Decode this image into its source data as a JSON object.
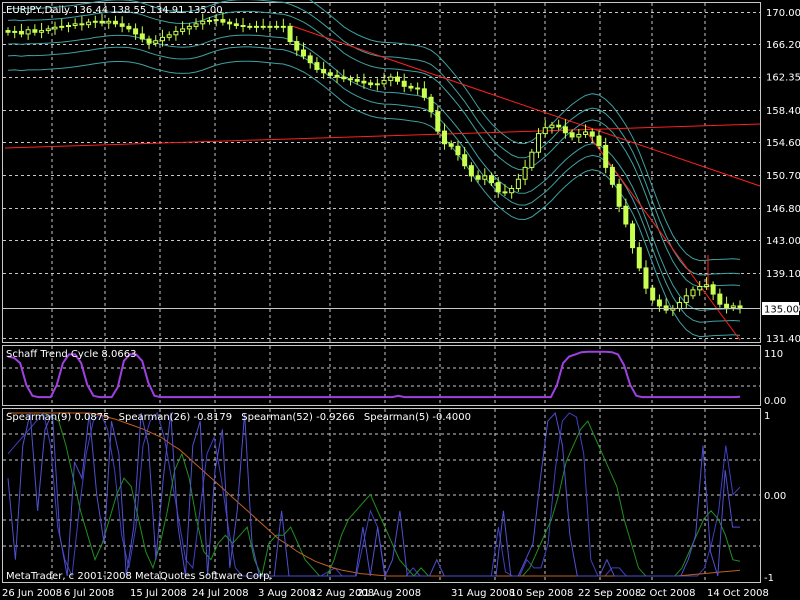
{
  "colors": {
    "background": "#000000",
    "grid": "#c8c8c8",
    "text": "#ffffff",
    "candle": "#c8ff50",
    "envelope": "#40a0a0",
    "trendline": "#ff2020",
    "stc": "#a040e0",
    "sp9": "#4040c0",
    "sp26": "#209020",
    "sp52": "#c06020",
    "sp5": "#5050d0"
  },
  "header": {
    "title": "EURJPY,Daily  136.44 138.55 134.91 135.00"
  },
  "current_price": "135.00",
  "footer": {
    "copyright": "MetaTrader, c 2001-2008 MetaQuotes Software Corp."
  },
  "chart_data": [
    {
      "type": "candlestick",
      "title": "EURJPY,Daily",
      "ohlc_header": "136.44 138.55 134.91 135.00",
      "ylim": [
        131.4,
        170.0
      ],
      "y_ticks": [
        "170.00",
        "166.20",
        "162.35",
        "158.40",
        "154.60",
        "150.70",
        "146.80",
        "143.00",
        "139.10",
        "135.00",
        "131.40"
      ],
      "x_ticks": [
        "26 Jun 2008",
        "6 Jul 2008",
        "15 Jul 2008",
        "24 Jul 2008",
        "3 Aug 2008",
        "12 Aug 2008",
        "21 Aug 2008",
        "31 Aug 2008",
        "10 Sep 2008",
        "22 Sep 2008",
        "2 Oct 2008",
        "14 Oct 2008"
      ],
      "closes": [
        167.6,
        167.7,
        167.4,
        167.9,
        167.6,
        167.8,
        168.0,
        168.2,
        168.3,
        168.4,
        168.6,
        168.5,
        168.8,
        168.9,
        168.7,
        168.9,
        168.6,
        168.3,
        168.0,
        167.4,
        166.8,
        166.3,
        166.6,
        167.0,
        167.3,
        167.7,
        168.0,
        168.3,
        168.6,
        168.9,
        169.0,
        169.1,
        168.8,
        168.6,
        168.4,
        168.3,
        168.3,
        168.3,
        168.3,
        168.3,
        168.3,
        168.3,
        166.5,
        165.5,
        164.8,
        164.0,
        163.2,
        162.8,
        162.5,
        162.3,
        162.1,
        162.0,
        161.8,
        161.6,
        161.4,
        161.5,
        161.9,
        162.3,
        161.8,
        161.2,
        161.0,
        160.9,
        159.9,
        158.2,
        155.9,
        154.4,
        154.1,
        153.1,
        151.8,
        150.6,
        150.2,
        150.6,
        149.8,
        148.7,
        148.6,
        149.1,
        150.2,
        151.6,
        153.4,
        155.6,
        156.3,
        156.6,
        156.4,
        155.7,
        155.2,
        155.5,
        155.8,
        155.3,
        154.2,
        151.6,
        149.6,
        147.0,
        144.9,
        142.1,
        139.7,
        137.3,
        135.9,
        135.2,
        134.7,
        134.9,
        135.6,
        136.4,
        137.1,
        137.5,
        137.7,
        136.6,
        135.4,
        135.0,
        135.2,
        135.0
      ],
      "reference_level": 135.0,
      "annotations": [
        "Bollinger-style envelope bands (3 upper, 3 lower)",
        "Red trend lines"
      ]
    },
    {
      "type": "line",
      "title": "Schaff Trend Cycle 8.0663",
      "ylim": [
        0,
        110
      ],
      "y_ticks": [
        "110",
        "0.00"
      ],
      "series": [
        {
          "name": "Schaff Trend Cycle",
          "values": [
            95,
            92,
            80,
            30,
            5,
            2,
            2,
            2,
            30,
            80,
            100,
            100,
            80,
            30,
            5,
            2,
            2,
            2,
            25,
            85,
            100,
            100,
            85,
            35,
            5,
            2,
            2,
            2,
            2,
            2,
            2,
            2,
            2,
            2,
            2,
            2,
            2,
            2,
            2,
            2,
            2,
            2,
            2,
            2,
            2,
            2,
            2,
            2,
            2,
            2,
            2,
            2,
            2,
            2,
            2,
            2,
            2,
            2,
            2,
            2,
            2,
            2,
            2,
            2,
            5,
            2,
            2,
            2,
            2,
            2,
            2,
            2,
            2,
            2,
            2,
            2,
            2,
            2,
            2,
            2,
            2,
            2,
            2,
            2,
            2,
            2,
            2,
            2,
            2,
            2,
            30,
            80,
            95,
            100,
            105,
            106,
            106,
            106,
            106,
            105,
            100,
            75,
            30,
            5,
            2,
            2,
            2,
            2,
            2,
            2,
            2,
            2,
            2,
            2,
            2,
            2,
            2,
            2,
            2,
            2,
            3
          ]
        }
      ]
    },
    {
      "type": "line",
      "title": "Spearman",
      "ylim": [
        -1,
        1
      ],
      "y_ticks": [
        "1",
        "0.00",
        "-1"
      ],
      "series": [
        {
          "name": "Spearman(9) 0.0875",
          "values": [
            0.5,
            0.6,
            0.7,
            0.8,
            0.9,
            1.0,
            0.6,
            -0.4,
            -0.8,
            -1.0,
            -0.2,
            0.5,
            0.9,
            1.0,
            0.8,
            0.3,
            -0.5,
            -0.9,
            -0.4,
            0.6,
            0.9,
            1.0,
            0.7,
            0.2,
            -0.3,
            -0.8,
            -0.9,
            -0.2,
            0.5,
            0.7,
            0.2,
            -0.4,
            -0.9,
            -1.0,
            -1.0,
            -1.0,
            -1.0,
            -1.0,
            -1.0,
            -1.0,
            -1.0,
            -1.0,
            -1.0,
            -1.0,
            -1.0,
            -0.95,
            -0.9,
            -1.0,
            -1.0,
            -1.0,
            -0.6,
            -0.2,
            -0.4,
            -1.0,
            -1.0,
            -1.0,
            -1.0,
            -0.9,
            -1.0,
            -1.0,
            -1.0,
            -1.0,
            -1.0,
            -1.0,
            -1.0,
            -1.0,
            -1.0,
            -1.0,
            -1.0,
            -0.4,
            -0.95,
            -1.0,
            -1.0,
            -0.8,
            -0.9,
            -0.9,
            -0.6,
            0.3,
            0.9,
            1.0,
            0.95,
            0.5,
            -0.8,
            -1.0,
            -1.0,
            -0.9,
            -0.9,
            -1.0,
            -1.0,
            -1.0,
            -1.0,
            -1.0,
            -1.0,
            -1.0,
            -1.0,
            -1.0,
            -1.0,
            -1.0,
            -0.9,
            -0.6,
            -0.2,
            0.6,
            0.0,
            0.09
          ]
        },
        {
          "name": "Spearman(26) -0.8179",
          "values": [
            1.0,
            1.0,
            1.0,
            1.0,
            1.0,
            1.0,
            0.95,
            0.9,
            0.6,
            0.2,
            -0.2,
            -0.5,
            -0.8,
            -0.6,
            -0.3,
            0.0,
            0.2,
            0.1,
            -0.3,
            -0.7,
            -0.9,
            -0.6,
            -0.2,
            0.3,
            0.5,
            0.2,
            -0.3,
            -0.7,
            -0.8,
            -0.6,
            -0.5,
            -0.6,
            -0.5,
            -0.4,
            -0.8,
            -1.0,
            -0.6,
            -0.5,
            -0.5,
            -0.4,
            -0.6,
            -0.8,
            -0.9,
            -1.0,
            -1.0,
            -0.8,
            -0.5,
            -0.3,
            -0.2,
            -0.1,
            0.0,
            -0.2,
            -0.4,
            -0.6,
            -0.8,
            -0.9,
            -1.0,
            -0.9,
            -1.0,
            -1.0,
            -1.0,
            -1.0,
            -1.0,
            -1.0,
            -1.0,
            -1.0,
            -1.0,
            -1.0,
            -1.0,
            -1.0,
            -1.0,
            -1.0,
            -0.9,
            -0.7,
            -0.5,
            -0.3,
            0.0,
            0.4,
            0.6,
            0.8,
            0.9,
            0.7,
            0.5,
            0.3,
            0.1,
            -0.3,
            -0.6,
            -0.9,
            -1.0,
            -1.0,
            -1.0,
            -1.0,
            -1.0,
            -0.9,
            -0.7,
            -0.5,
            -0.3,
            -0.2,
            -0.3,
            -0.5,
            -0.8,
            -0.82
          ]
        },
        {
          "name": "Spearman(52) -0.9266",
          "values": [
            1.0,
            1.0,
            1.0,
            1.0,
            1.0,
            1.0,
            1.0,
            1.0,
            1.0,
            1.0,
            0.98,
            0.95,
            0.92,
            0.88,
            0.84,
            0.8,
            0.75,
            0.7,
            0.62,
            0.55,
            0.45,
            0.35,
            0.25,
            0.15,
            0.05,
            -0.05,
            -0.15,
            -0.25,
            -0.35,
            -0.45,
            -0.55,
            -0.62,
            -0.7,
            -0.76,
            -0.82,
            -0.86,
            -0.9,
            -0.93,
            -0.95,
            -0.97,
            -0.98,
            -0.99,
            -1.0,
            -1.0,
            -1.0,
            -1.0,
            -1.0,
            -1.0,
            -1.0,
            -1.0,
            -1.0,
            -1.0,
            -1.0,
            -1.0,
            -1.0,
            -1.0,
            -1.0,
            -1.0,
            -1.0,
            -1.0,
            -1.0,
            -1.0,
            -1.0,
            -1.0,
            -1.0,
            -1.0,
            -1.0,
            -1.0,
            -1.0,
            -1.0,
            -1.0,
            -1.0,
            -1.0,
            -1.0,
            -1.0,
            -0.99,
            -0.98,
            -0.97,
            -0.96,
            -0.95,
            -0.94,
            -0.93
          ]
        },
        {
          "name": "Spearman(5) -0.4000",
          "values": [
            0.2,
            -0.8,
            0.6,
            1.0,
            -0.2,
            0.8,
            1.0,
            -0.5,
            -1.0,
            0.4,
            0.2,
            1.0,
            0.0,
            -0.6,
            0.9,
            0.5,
            -1.0,
            -0.4,
            1.0,
            0.6,
            -0.8,
            0.2,
            1.0,
            -0.4,
            -1.0,
            0.6,
            0.9,
            -1.0,
            0.3,
            0.8,
            -0.9,
            -0.2,
            1.0,
            -0.6,
            -1.0,
            -1.0,
            -1.0,
            -0.2,
            -1.0,
            -1.0,
            -1.0,
            -1.0,
            -1.0,
            -1.0,
            -1.0,
            -1.0,
            -1.0,
            -1.0,
            -0.4,
            -1.0,
            -0.4,
            -1.0,
            -0.8,
            -0.2,
            -1.0,
            -1.0,
            -1.0,
            -1.0,
            -0.8,
            -1.0,
            -1.0,
            -1.0,
            -1.0,
            -1.0,
            -1.0,
            -1.0,
            -1.0,
            -0.2,
            -1.0,
            -1.0,
            -0.8,
            -0.6,
            0.2,
            0.9,
            1.0,
            0.6,
            -0.5,
            -1.0,
            -1.0,
            -1.0,
            -1.0,
            -0.8,
            -1.0,
            -1.0,
            -1.0,
            -1.0,
            -1.0,
            -1.0,
            -1.0,
            -1.0,
            -1.0,
            -1.0,
            -0.8,
            -0.5,
            0.6,
            -0.7,
            -1.0,
            0.3,
            -0.4,
            -0.4
          ]
        }
      ]
    }
  ]
}
